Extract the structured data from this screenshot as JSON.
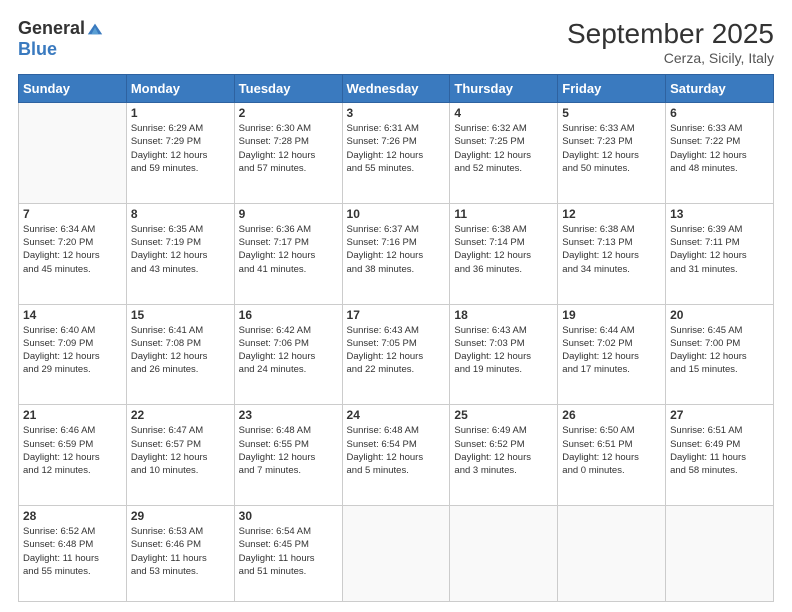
{
  "logo": {
    "general": "General",
    "blue": "Blue"
  },
  "title": "September 2025",
  "subtitle": "Cerza, Sicily, Italy",
  "days_header": [
    "Sunday",
    "Monday",
    "Tuesday",
    "Wednesday",
    "Thursday",
    "Friday",
    "Saturday"
  ],
  "weeks": [
    [
      {
        "day": "",
        "info": ""
      },
      {
        "day": "1",
        "info": "Sunrise: 6:29 AM\nSunset: 7:29 PM\nDaylight: 12 hours\nand 59 minutes."
      },
      {
        "day": "2",
        "info": "Sunrise: 6:30 AM\nSunset: 7:28 PM\nDaylight: 12 hours\nand 57 minutes."
      },
      {
        "day": "3",
        "info": "Sunrise: 6:31 AM\nSunset: 7:26 PM\nDaylight: 12 hours\nand 55 minutes."
      },
      {
        "day": "4",
        "info": "Sunrise: 6:32 AM\nSunset: 7:25 PM\nDaylight: 12 hours\nand 52 minutes."
      },
      {
        "day": "5",
        "info": "Sunrise: 6:33 AM\nSunset: 7:23 PM\nDaylight: 12 hours\nand 50 minutes."
      },
      {
        "day": "6",
        "info": "Sunrise: 6:33 AM\nSunset: 7:22 PM\nDaylight: 12 hours\nand 48 minutes."
      }
    ],
    [
      {
        "day": "7",
        "info": "Sunrise: 6:34 AM\nSunset: 7:20 PM\nDaylight: 12 hours\nand 45 minutes."
      },
      {
        "day": "8",
        "info": "Sunrise: 6:35 AM\nSunset: 7:19 PM\nDaylight: 12 hours\nand 43 minutes."
      },
      {
        "day": "9",
        "info": "Sunrise: 6:36 AM\nSunset: 7:17 PM\nDaylight: 12 hours\nand 41 minutes."
      },
      {
        "day": "10",
        "info": "Sunrise: 6:37 AM\nSunset: 7:16 PM\nDaylight: 12 hours\nand 38 minutes."
      },
      {
        "day": "11",
        "info": "Sunrise: 6:38 AM\nSunset: 7:14 PM\nDaylight: 12 hours\nand 36 minutes."
      },
      {
        "day": "12",
        "info": "Sunrise: 6:38 AM\nSunset: 7:13 PM\nDaylight: 12 hours\nand 34 minutes."
      },
      {
        "day": "13",
        "info": "Sunrise: 6:39 AM\nSunset: 7:11 PM\nDaylight: 12 hours\nand 31 minutes."
      }
    ],
    [
      {
        "day": "14",
        "info": "Sunrise: 6:40 AM\nSunset: 7:09 PM\nDaylight: 12 hours\nand 29 minutes."
      },
      {
        "day": "15",
        "info": "Sunrise: 6:41 AM\nSunset: 7:08 PM\nDaylight: 12 hours\nand 26 minutes."
      },
      {
        "day": "16",
        "info": "Sunrise: 6:42 AM\nSunset: 7:06 PM\nDaylight: 12 hours\nand 24 minutes."
      },
      {
        "day": "17",
        "info": "Sunrise: 6:43 AM\nSunset: 7:05 PM\nDaylight: 12 hours\nand 22 minutes."
      },
      {
        "day": "18",
        "info": "Sunrise: 6:43 AM\nSunset: 7:03 PM\nDaylight: 12 hours\nand 19 minutes."
      },
      {
        "day": "19",
        "info": "Sunrise: 6:44 AM\nSunset: 7:02 PM\nDaylight: 12 hours\nand 17 minutes."
      },
      {
        "day": "20",
        "info": "Sunrise: 6:45 AM\nSunset: 7:00 PM\nDaylight: 12 hours\nand 15 minutes."
      }
    ],
    [
      {
        "day": "21",
        "info": "Sunrise: 6:46 AM\nSunset: 6:59 PM\nDaylight: 12 hours\nand 12 minutes."
      },
      {
        "day": "22",
        "info": "Sunrise: 6:47 AM\nSunset: 6:57 PM\nDaylight: 12 hours\nand 10 minutes."
      },
      {
        "day": "23",
        "info": "Sunrise: 6:48 AM\nSunset: 6:55 PM\nDaylight: 12 hours\nand 7 minutes."
      },
      {
        "day": "24",
        "info": "Sunrise: 6:48 AM\nSunset: 6:54 PM\nDaylight: 12 hours\nand 5 minutes."
      },
      {
        "day": "25",
        "info": "Sunrise: 6:49 AM\nSunset: 6:52 PM\nDaylight: 12 hours\nand 3 minutes."
      },
      {
        "day": "26",
        "info": "Sunrise: 6:50 AM\nSunset: 6:51 PM\nDaylight: 12 hours\nand 0 minutes."
      },
      {
        "day": "27",
        "info": "Sunrise: 6:51 AM\nSunset: 6:49 PM\nDaylight: 11 hours\nand 58 minutes."
      }
    ],
    [
      {
        "day": "28",
        "info": "Sunrise: 6:52 AM\nSunset: 6:48 PM\nDaylight: 11 hours\nand 55 minutes."
      },
      {
        "day": "29",
        "info": "Sunrise: 6:53 AM\nSunset: 6:46 PM\nDaylight: 11 hours\nand 53 minutes."
      },
      {
        "day": "30",
        "info": "Sunrise: 6:54 AM\nSunset: 6:45 PM\nDaylight: 11 hours\nand 51 minutes."
      },
      {
        "day": "",
        "info": ""
      },
      {
        "day": "",
        "info": ""
      },
      {
        "day": "",
        "info": ""
      },
      {
        "day": "",
        "info": ""
      }
    ]
  ]
}
